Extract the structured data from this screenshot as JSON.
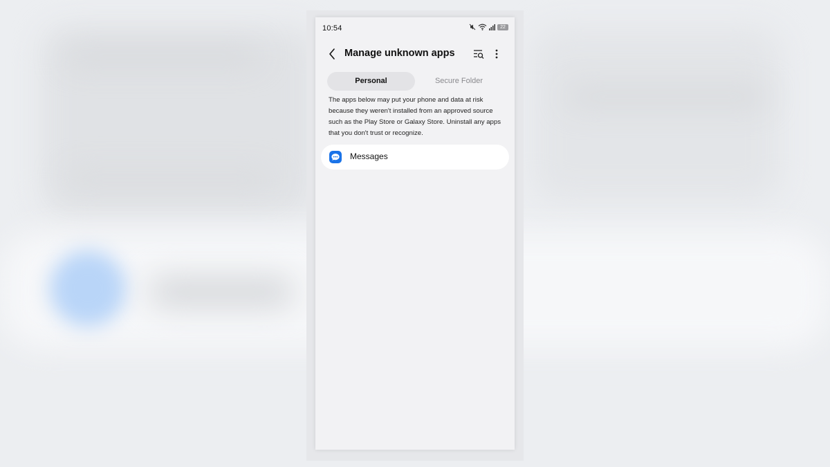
{
  "status_bar": {
    "time": "10:54",
    "battery": "22",
    "icons": [
      "mute-icon",
      "wifi-icon",
      "signal-icon",
      "battery-icon"
    ]
  },
  "header": {
    "title": "Manage unknown apps",
    "back_icon": "back-arrow-icon",
    "search_icon": "search-filter-icon",
    "more_icon": "more-options-icon"
  },
  "tabs": [
    {
      "label": "Personal",
      "selected": true
    },
    {
      "label": "Secure Folder",
      "selected": false
    }
  ],
  "description": "The apps below may put your phone and data at risk because they weren't installed from an approved source such as the Play Store or Galaxy Store. Uninstall any apps that you don't trust or recognize.",
  "apps": [
    {
      "name": "Messages",
      "icon": "messages-icon"
    }
  ],
  "colors": {
    "accent": "#1a73e8",
    "background": "#f2f2f4",
    "card": "#ffffff",
    "tab_selected": "#e3e3e6"
  }
}
